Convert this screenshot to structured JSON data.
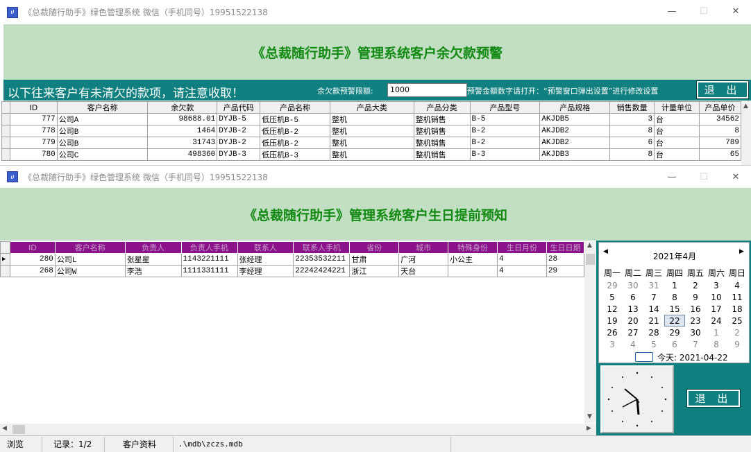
{
  "window1": {
    "title": "《总裁随行助手》绿色管理系统  微信（手机同号）19951522138",
    "banner": "《总裁随行助手》管理系统客户余欠款预警",
    "notice": "以下往来客户有未清欠的款项，请注意收取！",
    "limit_label": "余欠款预警限额:",
    "limit_value": "1000",
    "hint": "预警金额数字请打开：“预警窗口弹出设置”进行修改设置",
    "exit_label": "退 出",
    "columns": [
      "ID",
      "客户名称",
      "余欠款",
      "产品代码",
      "产品名称",
      "产品大类",
      "产品分类",
      "产品型号",
      "产品规格",
      "销售数量",
      "计量单位",
      "产品单价"
    ],
    "rows": [
      [
        "777",
        "公司A",
        "98688.01",
        "DYJB-5",
        "低压机B-5",
        "整机",
        "整机销售",
        "B-5",
        "AKJDB5",
        "3",
        "台",
        "34562"
      ],
      [
        "778",
        "公司B",
        "1464",
        "DYJB-2",
        "低压机B-2",
        "整机",
        "整机销售",
        "B-2",
        "AKJDB2",
        "8",
        "台",
        "8"
      ],
      [
        "779",
        "公司B",
        "31743",
        "DYJB-2",
        "低压机B-2",
        "整机",
        "整机销售",
        "B-2",
        "AKJDB2",
        "6",
        "台",
        "789"
      ],
      [
        "780",
        "公司C",
        "498360",
        "DYJB-3",
        "低压机B-3",
        "整机",
        "整机销售",
        "B-3",
        "AKJDB3",
        "8",
        "台",
        "65"
      ]
    ]
  },
  "window2": {
    "title": "《总裁随行助手》绿色管理系统  微信（手机同号）19951522138",
    "banner": "《总裁随行助手》管理系统客户生日提前预知",
    "exit_label": "退 出",
    "columns": [
      "ID",
      "客户名称",
      "负责人",
      "负责人手机",
      "联系人",
      "联系人手机",
      "省份",
      "城市",
      "特殊身份",
      "生日月份",
      "生日日期"
    ],
    "rows": [
      [
        "280",
        "公司L",
        "张星星",
        "1143221111",
        "张经理",
        "22353532211",
        "甘肃",
        "广河",
        "小公主",
        "4",
        "28"
      ],
      [
        "268",
        "公司W",
        "李浩",
        "1111331111",
        "李经理",
        "22242424221",
        "浙江",
        "天台",
        "",
        "4",
        "29"
      ]
    ],
    "calendar": {
      "month_label": "2021年4月",
      "weekdays": [
        "周一",
        "周二",
        "周三",
        "周四",
        "周五",
        "周六",
        "周日"
      ],
      "days": [
        "29",
        "30",
        "31",
        "1",
        "2",
        "3",
        "4",
        "5",
        "6",
        "7",
        "8",
        "9",
        "10",
        "11",
        "12",
        "13",
        "14",
        "15",
        "16",
        "17",
        "18",
        "19",
        "20",
        "21",
        "22",
        "23",
        "24",
        "25",
        "26",
        "27",
        "28",
        "29",
        "30",
        "1",
        "2",
        "3",
        "4",
        "5",
        "6",
        "7",
        "8",
        "9"
      ],
      "selected_day": "22",
      "today_label": "今天: 2021-04-22"
    },
    "status": [
      "浏览",
      "记录：1/2",
      "客户资料",
      ".\\mdb\\zczs.mdb"
    ]
  },
  "colors": {
    "banner_bg": "#c3dfc3",
    "banner_text": "#108a10",
    "teal": "#0f7f7f",
    "header_purple": "#8b128b"
  }
}
